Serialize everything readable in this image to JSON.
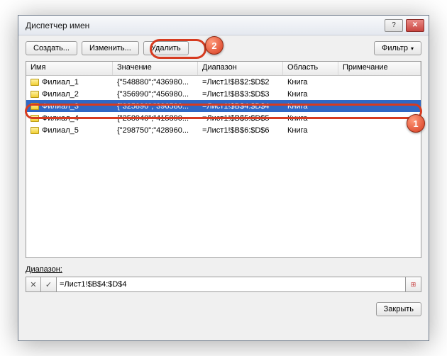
{
  "window": {
    "title": "Диспетчер имен"
  },
  "titlebar": {
    "help": "?",
    "close": "✕"
  },
  "toolbar": {
    "new": "Создать...",
    "edit": "Изменить...",
    "delete": "Удалить",
    "filter": "Фильтр"
  },
  "columns": {
    "name": "Имя",
    "value": "Значение",
    "range": "Диапазон",
    "scope": "Область",
    "note": "Примечание"
  },
  "rows": [
    {
      "name": "Филиал_1",
      "value": "{\"548880\";\"436980...",
      "range": "=Лист1!$B$2:$D$2",
      "scope": "Книга",
      "selected": false
    },
    {
      "name": "Филиал_2",
      "value": "{\"356990\";\"456980...",
      "range": "=Лист1!$B$3:$D$3",
      "scope": "Книга",
      "selected": false
    },
    {
      "name": "Филиал_3",
      "value": "{\"325890\";\"396580...",
      "range": "=Лист1!$B$4:$D$4",
      "scope": "Книга",
      "selected": true
    },
    {
      "name": "Филиал_4",
      "value": "{\"258940\";\"415890...",
      "range": "=Лист1!$B$5:$D$5",
      "scope": "Книга",
      "selected": false
    },
    {
      "name": "Филиал_5",
      "value": "{\"298750\";\"428960...",
      "range": "=Лист1!$B$6:$D$6",
      "scope": "Книга",
      "selected": false
    }
  ],
  "range": {
    "label": "Диапазон:",
    "value": "=Лист1!$B$4:$D$4",
    "x": "✕",
    "ok": "✓"
  },
  "footer": {
    "close": "Закрыть"
  },
  "callouts": {
    "c1": "1",
    "c2": "2"
  }
}
